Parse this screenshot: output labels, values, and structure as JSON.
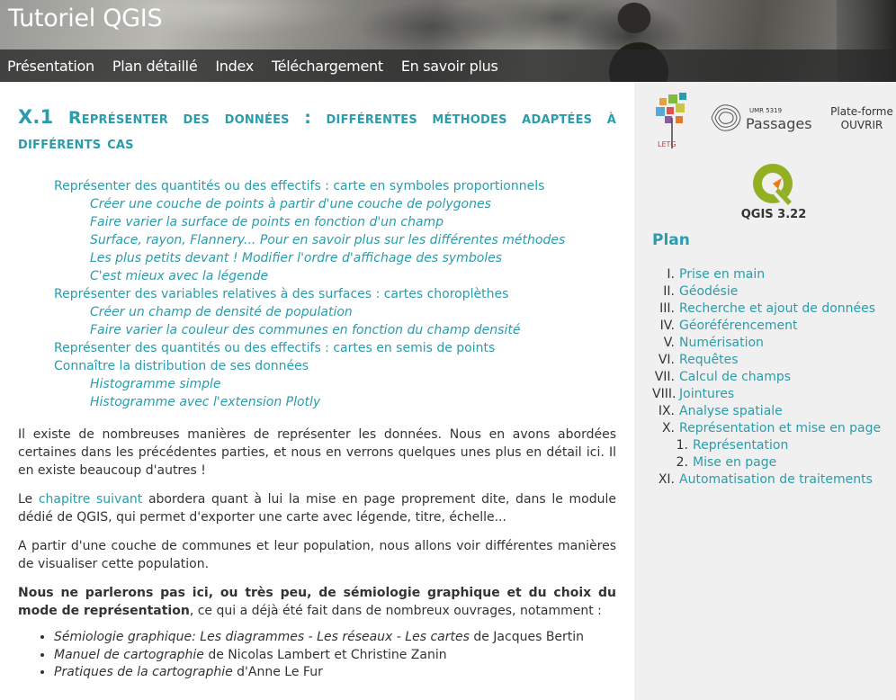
{
  "site": {
    "title": "Tutoriel QGIS",
    "nav": [
      "Présentation",
      "Plan détaillé",
      "Index",
      "Téléchargement",
      "En savoir plus"
    ]
  },
  "main": {
    "heading_num": "X.1",
    "heading_text": "Représenter des données : différentes méthodes adaptées à différents cas",
    "toc": [
      {
        "level": 1,
        "text": "Représenter des quantités ou des effectifs : carte en symboles proportionnels"
      },
      {
        "level": 2,
        "text": "Créer une couche de points à partir d'une couche de polygones"
      },
      {
        "level": 2,
        "text": "Faire varier la surface de points en fonction d'un champ"
      },
      {
        "level": 2,
        "text": "Surface, rayon, Flannery... Pour en savoir plus sur les différentes méthodes"
      },
      {
        "level": 2,
        "text": "Les plus petits devant ! Modifier l'ordre d'affichage des symboles"
      },
      {
        "level": 2,
        "text": "C'est mieux avec la légende"
      },
      {
        "level": 1,
        "text": "Représenter des variables relatives à des surfaces : cartes choroplèthes"
      },
      {
        "level": 2,
        "text": "Créer un champ de densité de population"
      },
      {
        "level": 2,
        "text": "Faire varier la couleur des communes en fonction du champ densité"
      },
      {
        "level": 1,
        "text": "Représenter des quantités ou des effectifs : cartes en semis de points"
      },
      {
        "level": 1,
        "text": "Connaître la distribution de ses données"
      },
      {
        "level": 2,
        "text": "Histogramme simple"
      },
      {
        "level": 2,
        "text": "Histogramme avec l'extension Plotly"
      }
    ],
    "para1": "Il existe de nombreuses manières de représenter les données. Nous en avons abordées certaines dans les précédentes parties, et nous en verrons quelques unes plus en détail ici. Il en existe beaucoup d'autres !",
    "para2_pre": "Le ",
    "para2_link": "chapitre suivant",
    "para2_post": " abordera quant à lui la mise en page proprement dite, dans le module dédié de QGIS, qui permet d'exporter une carte avec légende, titre, échelle...",
    "para3": "A partir d'une couche de communes et leur population, nous allons voir différentes manières de visualiser cette population.",
    "para4_bold": "Nous ne parlerons pas ici, ou très peu, de sémiologie graphique et du choix du mode de représentation",
    "para4_rest": ", ce qui a déjà été fait dans de nombreux ouvrages, notamment :",
    "refs": [
      {
        "italic": "Sémiologie graphique: Les diagrammes - Les réseaux - Les cartes",
        "rest": " de Jacques Bertin"
      },
      {
        "italic": "Manuel de cartographie",
        "rest": " de Nicolas Lambert et Christine Zanin"
      },
      {
        "italic": "Pratiques de la cartographie",
        "rest": " d'Anne Le Fur"
      }
    ]
  },
  "sidebar": {
    "letg_text": "LETG",
    "passages_umr": "UMR 5319",
    "passages_name": "Passages",
    "platform_line1": "Plate-forme",
    "platform_line2": "OUVRIR",
    "qgis_version": "QGIS 3.22",
    "plan_title": "Plan",
    "plan": [
      {
        "num": "I.",
        "label": "Prise en main"
      },
      {
        "num": "II.",
        "label": "Géodésie"
      },
      {
        "num": "III.",
        "label": "Recherche et ajout de données"
      },
      {
        "num": "IV.",
        "label": "Géoréférencement"
      },
      {
        "num": "V.",
        "label": "Numérisation"
      },
      {
        "num": "VI.",
        "label": "Requêtes"
      },
      {
        "num": "VII.",
        "label": "Calcul de champs"
      },
      {
        "num": "VIII.",
        "label": "Jointures"
      },
      {
        "num": "IX.",
        "label": "Analyse spatiale"
      },
      {
        "num": "X.",
        "label": "Représentation et mise en page"
      },
      {
        "num": "1.",
        "label": "Représentation",
        "sub": true
      },
      {
        "num": "2.",
        "label": "Mise en page",
        "sub": true
      },
      {
        "num": "XI.",
        "label": "Automatisation de traitements"
      }
    ]
  },
  "colors": {
    "accent": "#2a9cac",
    "sidebar_bg": "#f0f0f0",
    "nav_bg": "#282828"
  }
}
